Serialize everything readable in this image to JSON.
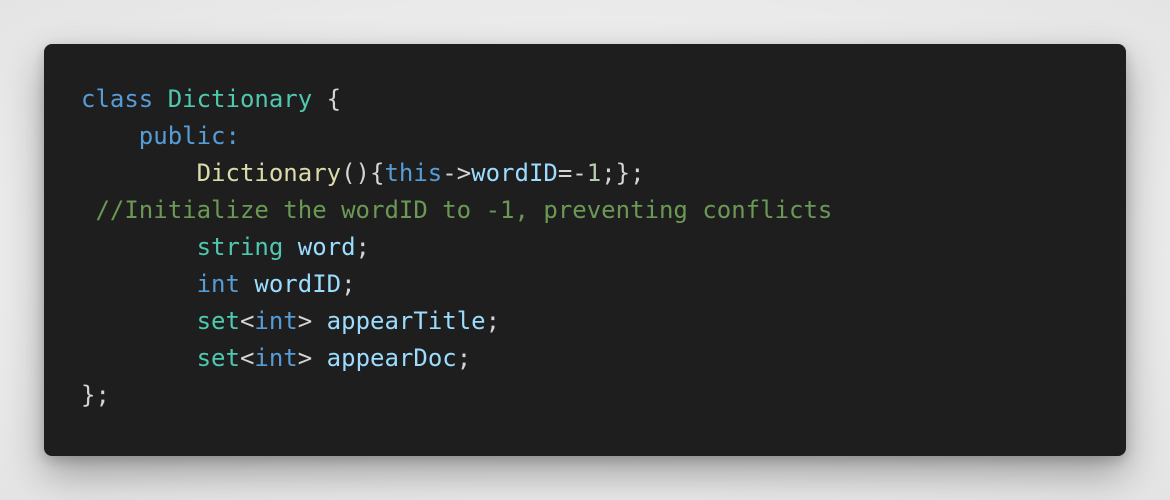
{
  "code": {
    "l1": {
      "kw": "class",
      "name": "Dictionary",
      "brace": "{"
    },
    "l2": {
      "access": "public",
      "colon": ":"
    },
    "l3": {
      "fn": "Dictionary",
      "parens": "()",
      "open": "{",
      "this": "this",
      "arrow": "->",
      "member": "wordID",
      "eq": "=-",
      "num": "1",
      "close": ";};"
    },
    "l4": {
      "comment": "//Initialize the wordID to -1, preventing conflicts"
    },
    "l5": {
      "type": "string",
      "name": "word",
      "semi": ";"
    },
    "l6": {
      "type": "int",
      "name": "wordID",
      "semi": ";"
    },
    "l7": {
      "type": "set",
      "lt": "<",
      "param": "int",
      "gt": ">",
      "name": "appearTitle",
      "semi": ";"
    },
    "l8": {
      "type": "set",
      "lt": "<",
      "param": "int",
      "gt": ">",
      "name": "appearDoc",
      "semi": ";"
    },
    "l9": {
      "close": "};"
    }
  },
  "colors": {
    "background": "#1e1e1e",
    "keyword": "#569cd6",
    "type": "#4ec9b0",
    "function": "#dcdcaa",
    "variable": "#9cdcfe",
    "number": "#b5cea8",
    "comment": "#6a9955",
    "punctuation": "#d4d4d4"
  }
}
